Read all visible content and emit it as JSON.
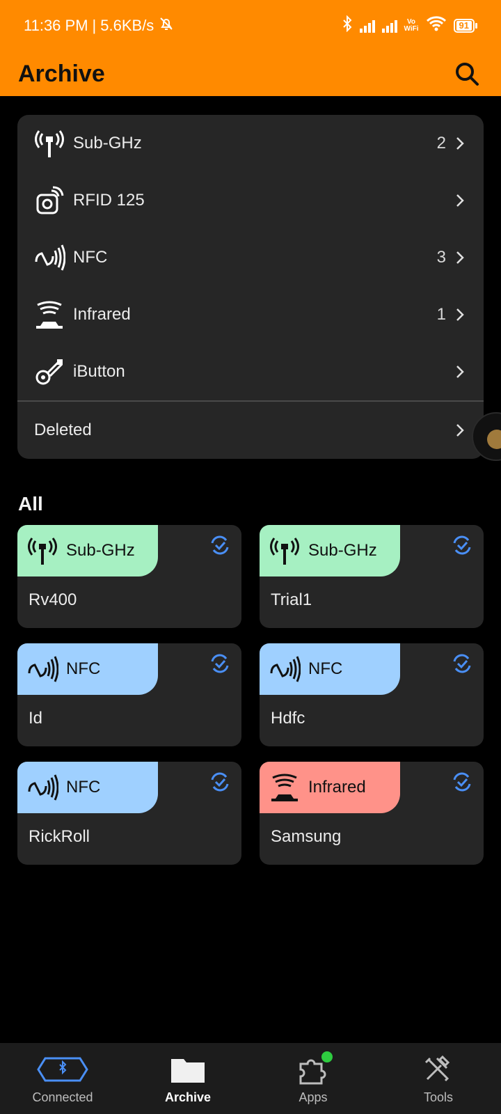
{
  "status_bar": {
    "time": "11:36 PM",
    "separator": "|",
    "speed": "5.6KB/s",
    "vowifi_top": "Vo",
    "vowifi_bottom": "WiFi",
    "battery": "91"
  },
  "header": {
    "title": "Archive"
  },
  "categories": [
    {
      "label": "Sub-GHz",
      "count": "2",
      "icon": "antenna-icon"
    },
    {
      "label": "RFID 125",
      "count": "",
      "icon": "rfid-icon"
    },
    {
      "label": "NFC",
      "count": "3",
      "icon": "nfc-icon"
    },
    {
      "label": "Infrared",
      "count": "1",
      "icon": "infrared-icon"
    },
    {
      "label": "iButton",
      "count": "",
      "icon": "ibutton-icon"
    }
  ],
  "deleted": {
    "label": "Deleted"
  },
  "all_section": {
    "title": "All"
  },
  "files": [
    {
      "type": "Sub-GHz",
      "name": "Rv400",
      "color": "#a6f0c2"
    },
    {
      "type": "Sub-GHz",
      "name": "Trial1",
      "color": "#a6f0c2"
    },
    {
      "type": "NFC",
      "name": "Id",
      "color": "#9fd0ff"
    },
    {
      "type": "NFC",
      "name": "Hdfc",
      "color": "#9fd0ff"
    },
    {
      "type": "NFC",
      "name": "RickRoll",
      "color": "#9fd0ff"
    },
    {
      "type": "Infrared",
      "name": "Samsung",
      "color": "#ff9289"
    }
  ],
  "nav": [
    {
      "label": "Connected"
    },
    {
      "label": "Archive"
    },
    {
      "label": "Apps"
    },
    {
      "label": "Tools"
    }
  ],
  "colors": {
    "accent": "#ff8a00",
    "sync_blue": "#4a8ff5",
    "subghz": "#a6f0c2",
    "nfc": "#9fd0ff",
    "infrared": "#ff9289"
  }
}
